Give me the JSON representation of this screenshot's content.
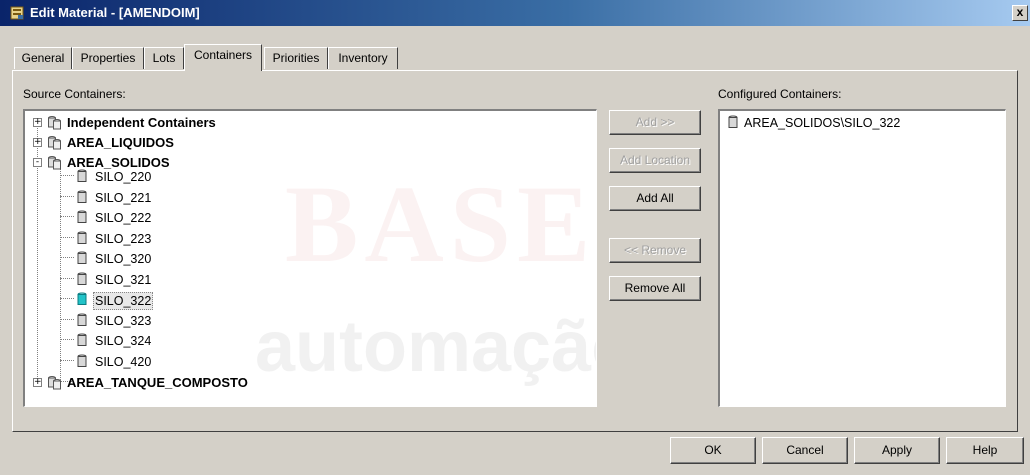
{
  "window": {
    "title": "Edit Material - [AMENDOIM]",
    "close_label": "x"
  },
  "tabs": [
    {
      "label": "General",
      "active": false
    },
    {
      "label": "Properties",
      "active": false
    },
    {
      "label": "Lots",
      "active": false
    },
    {
      "label": "Containers",
      "active": true
    },
    {
      "label": "Priorities",
      "active": false
    },
    {
      "label": "Inventory",
      "active": false
    }
  ],
  "source": {
    "label": "Source Containers:",
    "tree": [
      {
        "label": "Independent Containers",
        "expander": "+"
      },
      {
        "label": "AREA_LIQUIDOS",
        "expander": "+"
      },
      {
        "label": "AREA_SOLIDOS",
        "expander": "-",
        "children": [
          "SILO_220",
          "SILO_221",
          "SILO_222",
          "SILO_223",
          "SILO_320",
          "SILO_321",
          "SILO_322",
          "SILO_323",
          "SILO_324",
          "SILO_420"
        ]
      },
      {
        "label": "AREA_TANQUE_COMPOSTO",
        "expander": "+"
      }
    ],
    "selected_child": "SILO_322"
  },
  "configured": {
    "label": "Configured Containers:",
    "items": [
      "AREA_SOLIDOS\\SILO_322"
    ]
  },
  "watermark": {
    "line1": "BASE",
    "line2": "automação"
  },
  "middle_buttons": {
    "add": "Add >>",
    "add_location": "Add Location",
    "add_all": "Add All",
    "remove": "<< Remove",
    "remove_all": "Remove All"
  },
  "footer_buttons": {
    "ok": "OK",
    "cancel": "Cancel",
    "apply": "Apply",
    "help": "Help"
  },
  "colors": {
    "dialog_face": "#d4d0c8",
    "title_gradient_start": "#0a246a",
    "title_gradient_end": "#a6caf0",
    "selected_silo_icon": "#22c3c8"
  }
}
